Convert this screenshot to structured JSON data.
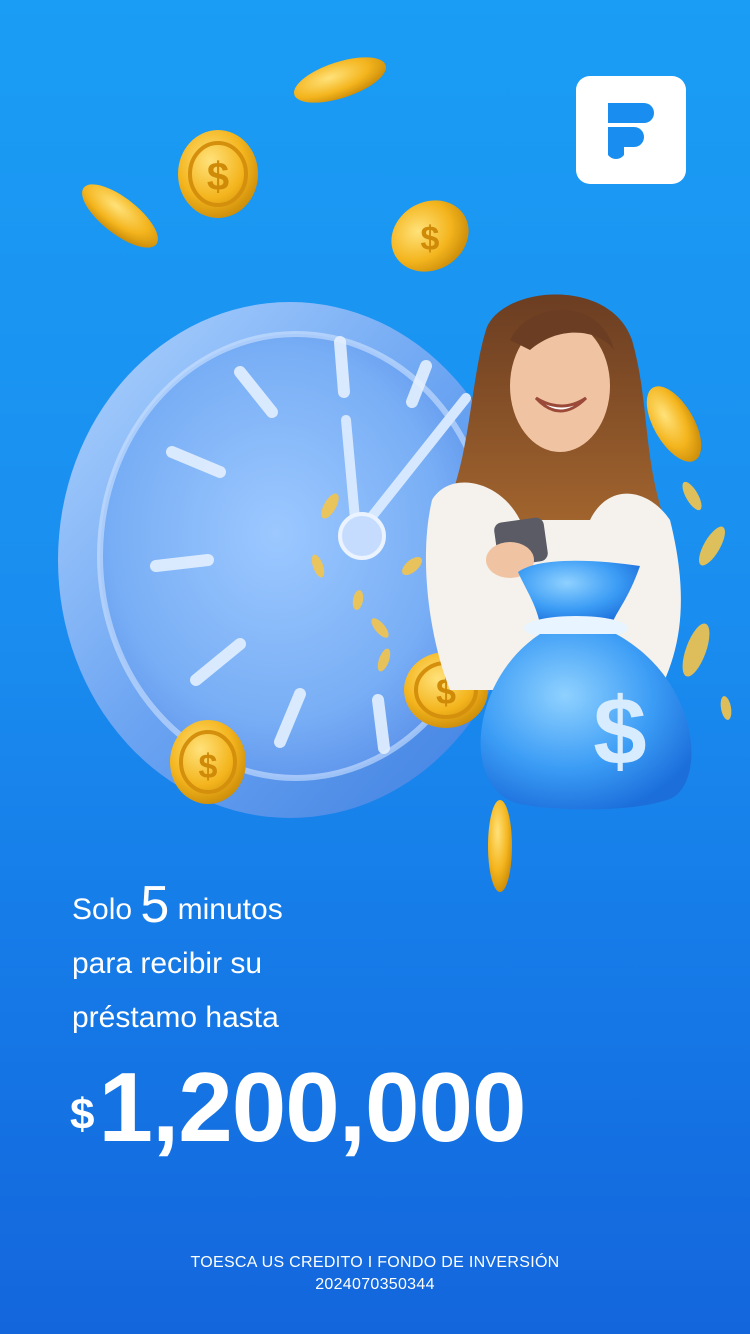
{
  "brand": {
    "logo_icon": "brand-f-icon",
    "logo_color": "#1a8ef0"
  },
  "colors": {
    "background_top": "#1a9df4",
    "background_bottom": "#1466dc",
    "coin": "#f2b91f",
    "text": "#ffffff"
  },
  "headline": {
    "line1_prefix": "Solo",
    "line1_number": "5",
    "line1_suffix": "minutos",
    "line2": "para recibir su",
    "line3": "préstamo hasta"
  },
  "amount": {
    "currency": "$",
    "value": "1,200,000"
  },
  "footer": {
    "company": "TOESCA US CREDITO I FONDO DE INVERSIÓN",
    "registration": "2024070350344"
  }
}
